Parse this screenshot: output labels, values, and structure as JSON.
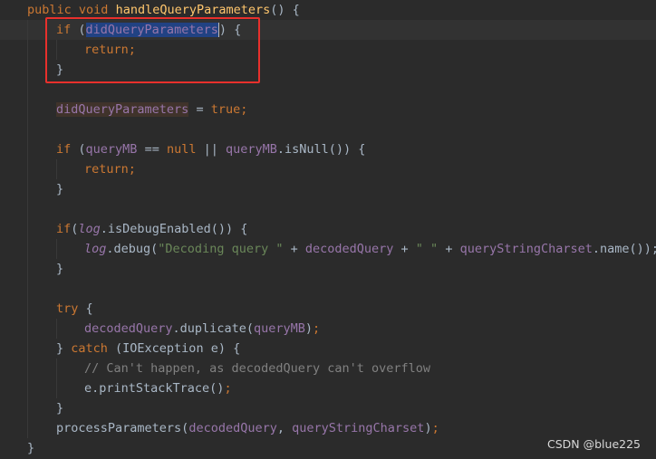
{
  "code": {
    "l1": {
      "public": "public",
      "void": "void",
      "method": "handleQueryParameters",
      "rest": "() {"
    },
    "l2": {
      "if": "if",
      "open": " (",
      "field": "didQueryParameters",
      "close": ") {"
    },
    "l3": {
      "return": "return",
      "semi": ";"
    },
    "l4": {
      "brace": "}"
    },
    "l6": {
      "field": "didQueryParameters",
      "eq": " = ",
      "true": "true",
      "semi": ";"
    },
    "l8": {
      "if": "if",
      "open": " (",
      "field1": "queryMB",
      "eqeq": " == ",
      "null": "null",
      "or": " || ",
      "field2": "queryMB",
      "call": ".isNull()) {"
    },
    "l9": {
      "return": "return",
      "semi": ";"
    },
    "l10": {
      "brace": "}"
    },
    "l12": {
      "if": "if",
      "open": "(",
      "log": "log",
      "call": ".isDebugEnabled()) {"
    },
    "l13": {
      "log": "log",
      "debug": ".debug(",
      "str1": "\"Decoding query \"",
      "plus1": " + ",
      "field1": "decodedQuery",
      "plus2": " + ",
      "str2": "\" \"",
      "plus3": " + ",
      "field2": "queryStringCharset",
      "end": ".name());"
    },
    "l14": {
      "brace": "}"
    },
    "l16": {
      "try": "try",
      "rest": " {"
    },
    "l17": {
      "field1": "decodedQuery",
      "call": ".duplicate(",
      "field2": "queryMB",
      "end": ")",
      "semi": ";"
    },
    "l18": {
      "brace": "} ",
      "catch": "catch",
      "rest": " (IOException e) {"
    },
    "l19": {
      "comment": "// Can't happen, as decodedQuery can't overflow"
    },
    "l20": {
      "call": "e.printStackTrace()",
      "semi": ";"
    },
    "l21": {
      "brace": "}"
    },
    "l22": {
      "call": "processParameters(",
      "field1": "decodedQuery",
      "comma": ", ",
      "field2": "queryStringCharset",
      "end": ")",
      "semi": ";"
    },
    "l23": {
      "brace": "}"
    }
  },
  "watermark": "CSDN @blue225",
  "colors": {
    "background": "#2b2b2b",
    "keyword": "#cc7832",
    "method": "#ffc66d",
    "field": "#9876aa",
    "string": "#6a8759",
    "comment": "#808080",
    "text": "#a9b7c6",
    "selection": "#214283",
    "annotation_box": "#e8302c"
  }
}
